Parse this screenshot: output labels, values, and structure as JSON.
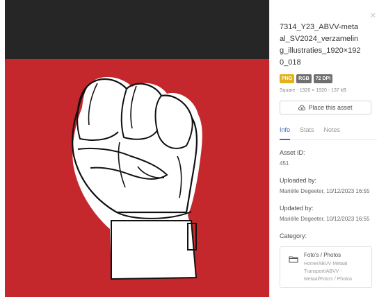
{
  "preview": {
    "colors": {
      "top": "#262626",
      "background": "#c4282d",
      "fist": "#ffffff",
      "outline": "#111111"
    }
  },
  "panel": {
    "close_icon": "close-icon",
    "filename": "7314_Y23_ABVV-metaal_SV2024_verzameling_illustraties_1920×1920_018",
    "badges": [
      "PNG",
      "RGB",
      "72 DPI"
    ],
    "meta": "Square - 1920 × 1920 - 137 kB",
    "place_button": "Place this asset",
    "tabs": [
      "Info",
      "Stats",
      "Notes"
    ],
    "active_tab": "Info",
    "asset_id_label": "Asset ID:",
    "asset_id_value": "451",
    "uploaded_label": "Uploaded by:",
    "uploaded_value": "Mariëlle Degeeter, 10/12/2023 16:55",
    "updated_label": "Updated by:",
    "updated_value": "Mariëlle Degeeter, 10/12/2023 16:55",
    "category_label": "Category:",
    "category_title": "Foto's / Photos",
    "category_path": "Home/ABVV Metaal Transport/ABVV - Metaal/Foto's / Photos"
  }
}
